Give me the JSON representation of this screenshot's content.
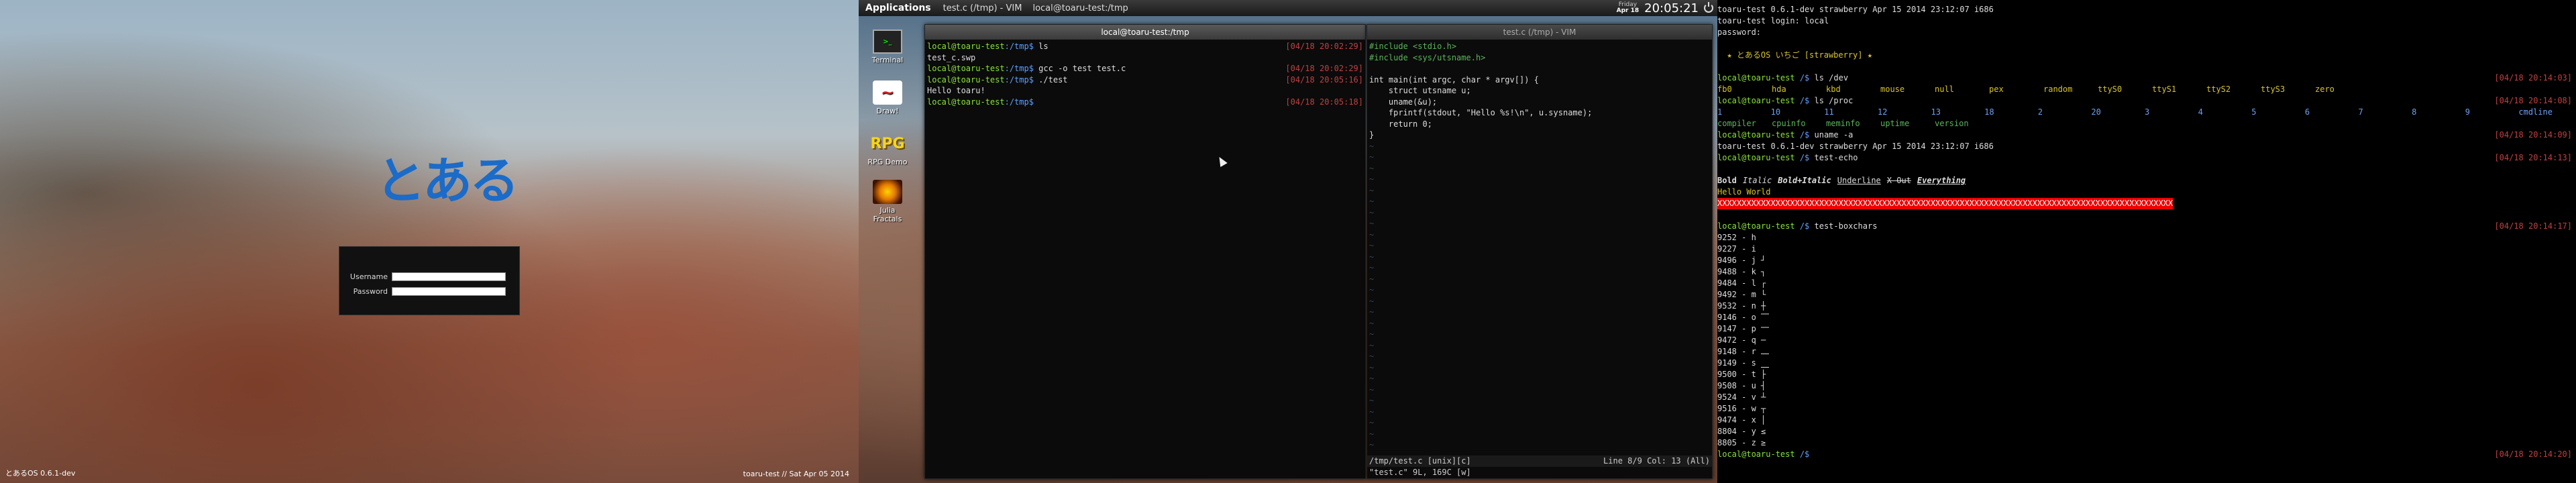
{
  "login": {
    "logo_text": "とある",
    "username_label": "Username",
    "password_label": "Password",
    "username_value": "",
    "password_value": "",
    "version_text": "とあるOS 0.6.1-dev",
    "host_text": "toaru-test // Sat Apr 05 2014"
  },
  "desktop": {
    "panel": {
      "applications_label": "Applications",
      "tasks": [
        "test.c (/tmp) - VIM",
        "local@toaru-test:/tmp"
      ],
      "date_day": "Friday",
      "date_short": "Apr 18",
      "clock": "20:05:21"
    },
    "icons": [
      {
        "label": "Terminal",
        "icon": "terminal-icon"
      },
      {
        "label": "Draw!",
        "icon": "draw-icon"
      },
      {
        "label": "RPG Demo",
        "icon": "rpg-icon"
      },
      {
        "label": "Julia Fractals",
        "icon": "fractal-icon"
      }
    ],
    "terminal": {
      "title": "local@toaru-test:/tmp",
      "lines": [
        {
          "user": "local@toaru-test",
          "path": ":/tmp$",
          "cmd": " ls",
          "ts": "[04/18 20:02:29]"
        },
        {
          "out": "test_c.swp",
          "ts": ""
        },
        {
          "user": "local@toaru-test",
          "path": ":/tmp$",
          "cmd": " gcc -o test test.c",
          "ts": "[04/18 20:02:29]"
        },
        {
          "user": "local@toaru-test",
          "path": ":/tmp$",
          "cmd": " ./test",
          "ts": "[04/18 20:05:16]"
        },
        {
          "out": "Hello toaru!",
          "ts": ""
        },
        {
          "user": "local@toaru-test",
          "path": ":/tmp$",
          "cmd": "",
          "ts": "[04/18 20:05:18]"
        }
      ]
    },
    "vim": {
      "title": "test.c (/tmp) - VIM",
      "lines": [
        {
          "t": "#include <stdio.h>",
          "c": "green"
        },
        {
          "t": "#include <sys/utsname.h>",
          "c": "green"
        },
        {
          "t": "",
          "c": "out"
        },
        {
          "t": "int main(int argc, char * argv[]) {",
          "c": "out"
        },
        {
          "t": "    struct utsname u;",
          "c": "out"
        },
        {
          "t": "    uname(&u);",
          "c": "out"
        },
        {
          "t": "    fprintf(stdout, \"Hello %s!\\n\", u.sysname);",
          "c": "out"
        },
        {
          "t": "    return 0;",
          "c": "out"
        },
        {
          "t": "}",
          "c": "out"
        }
      ],
      "status_left": "/tmp/test.c [unix][c]",
      "status_right": "Line 8/9 Col: 13 (All)",
      "message": "\"test.c\" 9L, 169C [w]"
    }
  },
  "console": {
    "boot_line": "toaru-test 0.6.1-dev strawberry Apr 15 2014 23:12:07 i686",
    "login_line": "toaru-test login: local",
    "password_line": "password:",
    "motd": "  ★ とあるOS いちご [strawberry] ★",
    "prompt_user": "local@toaru-test",
    "prompt_path": " /$",
    "cmds": [
      {
        "cmd": " ls /dev",
        "ts": "[04/18 20:14:03]"
      },
      {
        "cmd": " ls /proc",
        "ts": "[04/18 20:14:08]"
      },
      {
        "cmd": " uname -a",
        "ts": "[04/18 20:14:09]"
      },
      {
        "cmd": " test-echo",
        "ts": "[04/18 20:14:13]"
      },
      {
        "cmd": " test-boxchars",
        "ts": "[04/18 20:14:17]"
      },
      {
        "cmd": "",
        "ts": "[04/18 20:14:20]"
      }
    ],
    "dev_entries": [
      "fb0",
      "hda",
      "kbd",
      "mouse",
      "null",
      "pex",
      "random",
      "ttyS0",
      "ttyS1",
      "ttyS2",
      "ttyS3",
      "zero"
    ],
    "proc_nums": [
      "1",
      "10",
      "11",
      "12",
      "13",
      "18",
      "2",
      "20",
      "3",
      "4",
      "5",
      "6",
      "7",
      "8",
      "9",
      "cmdline"
    ],
    "proc_names": [
      "compiler",
      "cpuinfo",
      "meminfo",
      "uptime",
      "version"
    ],
    "uname_out": "toaru-test 0.6.1-dev strawberry Apr 15 2014 23:12:07 i686",
    "echo_styles": [
      "Bold",
      "Italic",
      "Bold+Italic",
      "Underline",
      "X-Out",
      "Everything"
    ],
    "hello": "Hello World",
    "xbar": "XXXXXXXXXXXXXXXXXXXXXXXXXXXXXXXXXXXXXXXXXXXXXXXXXXXXXXXXXXXXXXXXXXXXXXXXXXXXXXXXXXXXXXXXXXXXXX",
    "boxchars": [
      "9252 - h",
      "9227 - i",
      "9496 - j ┘",
      "9488 - k ┐",
      "9484 - l ┌",
      "9492 - m └",
      "9532 - n ┼",
      "9146 - o ⎺",
      "9147 - p ⎻",
      "9472 - q ─",
      "9148 - r ⎼",
      "9149 - s ⎽",
      "9500 - t ├",
      "9508 - u ┤",
      "9524 - v ┴",
      "9516 - w ┬",
      "9474 - x │",
      "8804 - y ≤",
      "8805 - z ≥"
    ]
  }
}
